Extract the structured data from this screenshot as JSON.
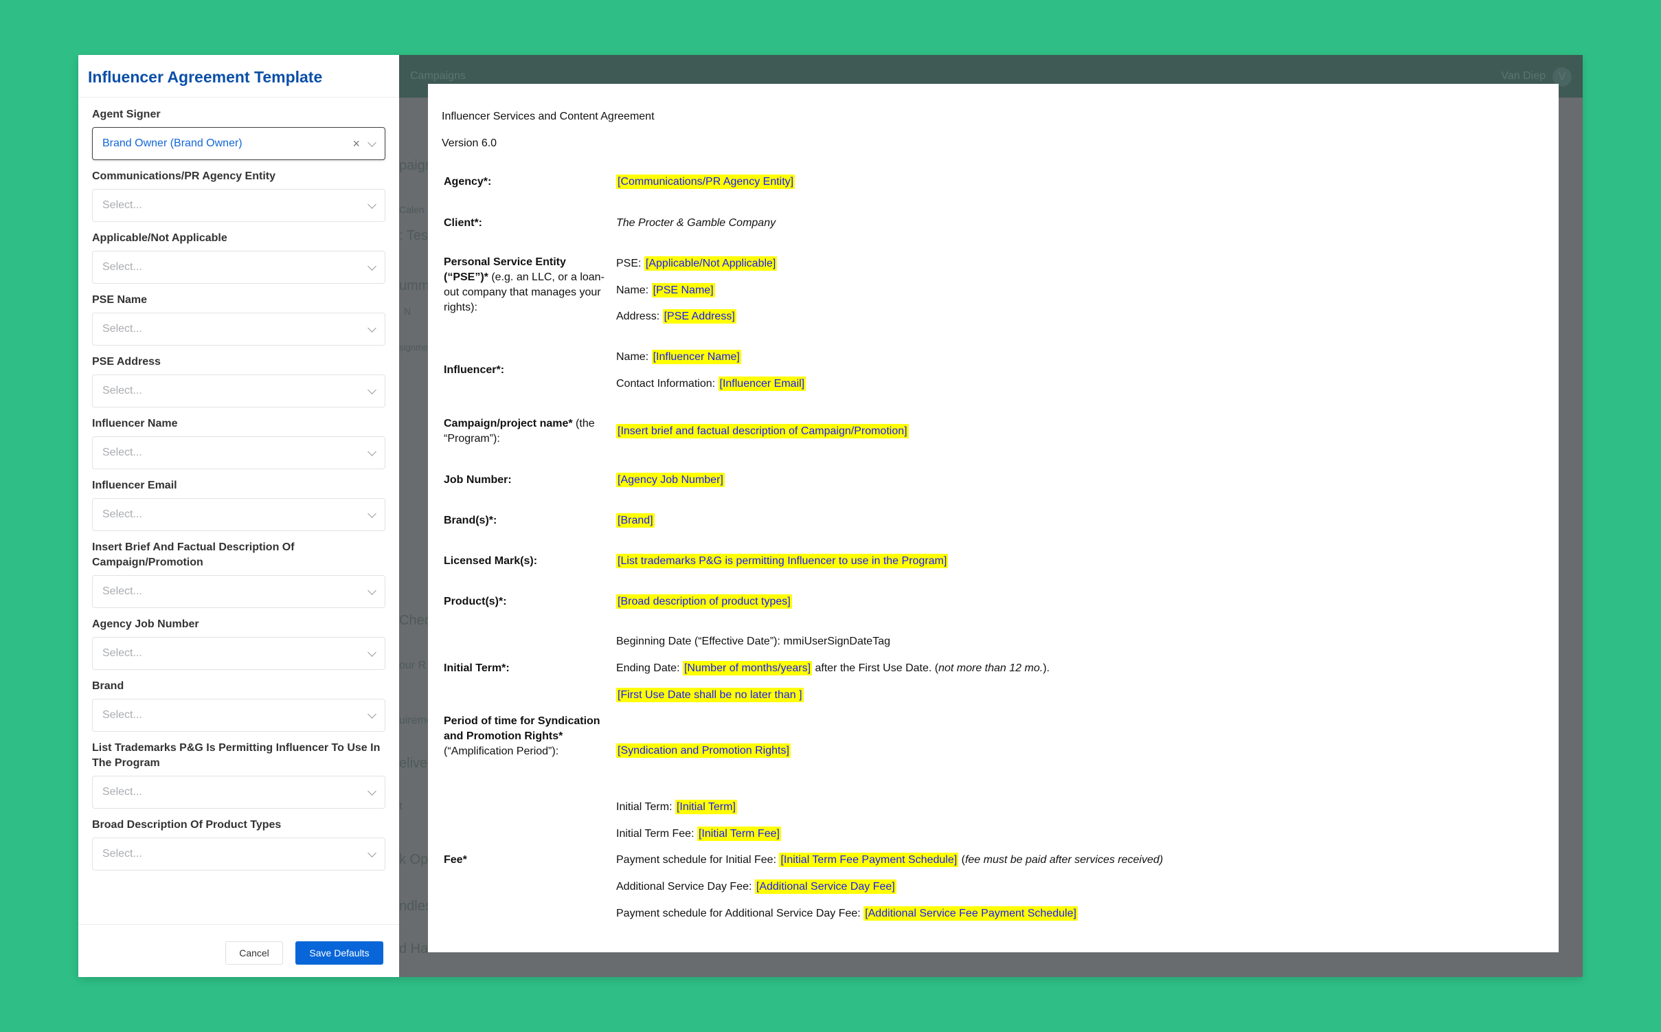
{
  "background": {
    "header_left": "Campaigns",
    "user_name": "Van Diep",
    "avatar_initial": "V",
    "fragments": [
      "paign",
      "Calen",
      ": Test",
      "umma",
      "N",
      "signme",
      "Check",
      "our R",
      "uireme",
      "elive",
      "t",
      "k Opt",
      "ndles",
      "d Ha"
    ]
  },
  "colors": {
    "background": "#2fbf86",
    "title": "#0a4fa8",
    "primary_button": "#0866d8",
    "highlight": "#ffff00",
    "placeholder_text": "#1a1aff"
  },
  "panel": {
    "title": "Influencer Agreement Template",
    "fields": [
      {
        "label": "Agent Signer",
        "value": "Brand Owner (Brand Owner)",
        "clearable": true
      },
      {
        "label": "Communications/PR Agency Entity",
        "placeholder": "Select..."
      },
      {
        "label": "Applicable/Not Applicable",
        "placeholder": "Select..."
      },
      {
        "label": "PSE Name",
        "placeholder": "Select..."
      },
      {
        "label": "PSE Address",
        "placeholder": "Select..."
      },
      {
        "label": "Influencer Name",
        "placeholder": "Select..."
      },
      {
        "label": "Influencer Email",
        "placeholder": "Select..."
      },
      {
        "label": "Insert Brief And Factual Description Of Campaign/Promotion",
        "placeholder": "Select..."
      },
      {
        "label": "Agency Job Number",
        "placeholder": "Select..."
      },
      {
        "label": "Brand",
        "placeholder": "Select..."
      },
      {
        "label": "List Trademarks P&G Is Permitting Influencer To Use In The Program",
        "placeholder": "Select..."
      },
      {
        "label": "Broad Description Of Product Types",
        "placeholder": "Select..."
      }
    ],
    "cancel_label": "Cancel",
    "save_label": "Save Defaults"
  },
  "document": {
    "title": "Influencer Services and Content Agreement",
    "version": "Version 6.0",
    "rows": [
      {
        "label": [
          {
            "t": "Agency*:",
            "s": "b"
          }
        ],
        "lines": [
          [
            {
              "t": "[Communications/PR Agency Entity]",
              "s": "ph"
            }
          ]
        ]
      },
      {
        "label": [
          {
            "t": "Client*:",
            "s": "b"
          }
        ],
        "lines": [
          [
            {
              "t": "The Procter & Gamble Company",
              "s": "i"
            }
          ]
        ]
      },
      {
        "label": [
          {
            "t": "Personal Service Entity (“PSE”)*",
            "s": "b"
          },
          {
            "t": " (e.g. an LLC, or a loan-out company that manages your rights):"
          }
        ],
        "lines": [
          [
            {
              "t": "PSE: "
            },
            {
              "t": "[Applicable/Not Applicable]",
              "s": "ph"
            }
          ],
          [
            {
              "t": "Name: "
            },
            {
              "t": "[PSE Name]",
              "s": "ph"
            }
          ],
          [
            {
              "t": "Address: "
            },
            {
              "t": "[PSE Address]",
              "s": "ph"
            }
          ]
        ]
      },
      {
        "label": [
          {
            "t": "Influencer*:",
            "s": "b"
          }
        ],
        "lines": [
          [
            {
              "t": "Name: "
            },
            {
              "t": "[Influencer Name]",
              "s": "ph"
            }
          ],
          [
            {
              "t": "Contact Information: "
            },
            {
              "t": "[Influencer Email]",
              "s": "ph"
            }
          ]
        ]
      },
      {
        "label": [
          {
            "t": "Campaign/project name*",
            "s": "b"
          },
          {
            "t": " (the “Program”):"
          }
        ],
        "lines": [
          [
            {
              "t": "[Insert brief and factual description of Campaign/Promotion]",
              "s": "ph"
            }
          ]
        ]
      },
      {
        "label": [
          {
            "t": "Job Number:",
            "s": "b"
          }
        ],
        "lines": [
          [
            {
              "t": "[Agency Job Number]",
              "s": "ph"
            }
          ]
        ]
      },
      {
        "label": [
          {
            "t": "Brand(s)*:",
            "s": "b"
          }
        ],
        "lines": [
          [
            {
              "t": "[Brand]",
              "s": "ph"
            }
          ]
        ]
      },
      {
        "label": [
          {
            "t": "Licensed Mark(s):",
            "s": "b"
          }
        ],
        "lines": [
          [
            {
              "t": "[List trademarks P&G is permitting Influencer to use in the Program]",
              "s": "ph"
            }
          ]
        ]
      },
      {
        "label": [
          {
            "t": "Product(s)*:",
            "s": "b"
          }
        ],
        "lines": [
          [
            {
              "t": "[Broad description of product types]",
              "s": "ph"
            }
          ]
        ]
      },
      {
        "label": [
          {
            "t": "Initial Term*:",
            "s": "b"
          }
        ],
        "lines": [
          [
            {
              "t": "Beginning Date (“Effective Date”): mmiUserSignDateTag"
            }
          ],
          [
            {
              "t": "Ending Date: "
            },
            {
              "t": "[Number of months/years]",
              "s": "ph"
            },
            {
              "t": " after the First Use Date. ("
            },
            {
              "t": "not more than 12 mo.",
              "s": "i"
            },
            {
              "t": ")."
            }
          ],
          [
            {
              "t": "[First Use Date shall be no later than ]",
              "s": "ph"
            }
          ]
        ]
      },
      {
        "label": [
          {
            "t": "Period of time for Syndication and Promotion Rights*",
            "s": "b"
          },
          {
            "t": " (“Amplification Period”):"
          }
        ],
        "lines": [
          [
            {
              "t": "[Syndication and Promotion Rights]",
              "s": "ph"
            }
          ]
        ]
      },
      {
        "label": [
          {
            "t": "Fee*",
            "s": "b"
          }
        ],
        "lines": [
          [
            {
              "t": "Initial Term: "
            },
            {
              "t": "[Initial Term]",
              "s": "ph"
            }
          ],
          [
            {
              "t": "Initial Term Fee: "
            },
            {
              "t": "[Initial Term Fee]",
              "s": "ph"
            }
          ],
          [
            {
              "t": "Payment schedule for Initial Fee: "
            },
            {
              "t": "[Initial Term Fee Payment Schedule]",
              "s": "ph"
            },
            {
              "t": " ("
            },
            {
              "t": "fee must be paid after services received)",
              "s": "i"
            }
          ],
          [
            {
              "t": "Additional Service Day Fee: "
            },
            {
              "t": "[Additional Service Day Fee]",
              "s": "ph"
            }
          ],
          [
            {
              "t": "Payment schedule for Additional Service Day Fee: "
            },
            {
              "t": "[Additional Service Fee Payment Schedule]",
              "s": "ph"
            }
          ]
        ]
      }
    ]
  }
}
